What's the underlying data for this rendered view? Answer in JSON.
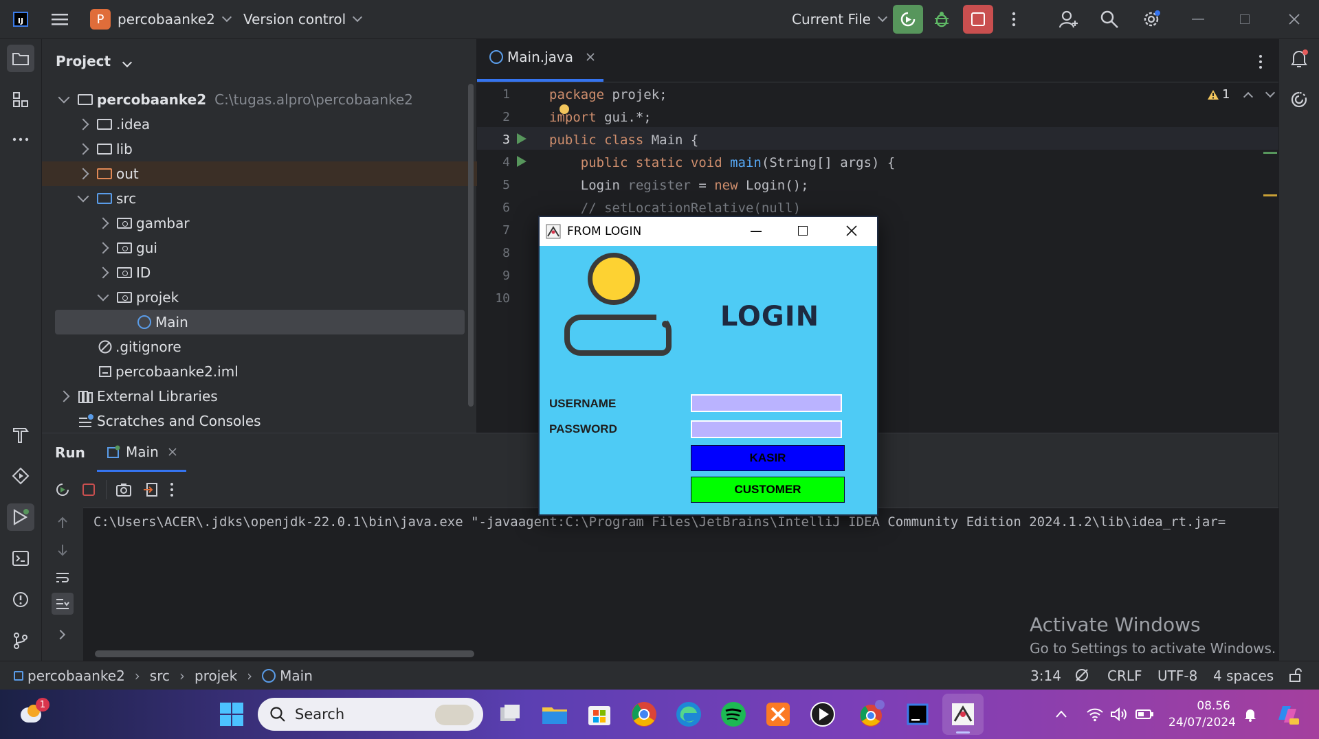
{
  "titlebar": {
    "project_badge": "P",
    "project_name": "percobaanke2",
    "vcs_label": "Version control",
    "run_config": "Current File"
  },
  "project_panel": {
    "header": "Project",
    "root_name": "percobaanke2",
    "root_path": "C:\\tugas.alpro\\percobaanke2",
    "items": [
      {
        "label": ".idea"
      },
      {
        "label": "lib"
      },
      {
        "label": "out"
      },
      {
        "label": "src"
      },
      {
        "label": "gambar"
      },
      {
        "label": "gui"
      },
      {
        "label": "ID"
      },
      {
        "label": "projek"
      },
      {
        "label": "Main"
      },
      {
        "label": ".gitignore"
      },
      {
        "label": "percobaanke2.iml"
      },
      {
        "label": "External Libraries"
      },
      {
        "label": "Scratches and Consoles"
      }
    ]
  },
  "editor": {
    "tab_label": "Main.java",
    "warning_count": "1",
    "line_numbers": [
      "1",
      "2",
      "3",
      "4",
      "5",
      "6",
      "7",
      "8",
      "9",
      "10"
    ],
    "code": {
      "l1_kw": "package",
      "l1_rest": " projek;",
      "l2_kw": "import",
      "l2_rest": " gui.*;",
      "l3_kw": "public class",
      "l3_name": " Main",
      "l3_rest": " {",
      "l4_kw": "    public static void",
      "l4_fn": " main",
      "l4_rest": "(String[] args) {",
      "l5_a": "    Login ",
      "l5_var": "register",
      "l5_b": " = ",
      "l5_kw": "new",
      "l5_c": " Login();",
      "l6_comment": "    // setLocationRelative(null)"
    }
  },
  "run_panel": {
    "title": "Run",
    "tab_label": "Main",
    "console_line": "C:\\Users\\ACER\\.jdks\\openjdk-22.0.1\\bin\\java.exe \"-javaagent:C:\\Program Files\\JetBrains\\IntelliJ IDEA Community Edition 2024.1.2\\lib\\idea_rt.jar=",
    "watermark_title": "Activate Windows",
    "watermark_sub": "Go to Settings to activate Windows."
  },
  "statusbar": {
    "crumbs": [
      "percobaanke2",
      "src",
      "projek",
      "Main"
    ],
    "position": "3:14",
    "line_sep": "CRLF",
    "encoding": "UTF-8",
    "indent": "4 spaces"
  },
  "dialog": {
    "title": "FROM LOGIN",
    "heading": "LOGIN",
    "username_label": "USERNAME",
    "password_label": "PASSWORD",
    "kasir_button": "KASIR",
    "customer_button": "CUSTOMER",
    "colors": {
      "bg": "#4ecbf5",
      "kasir": "#0000ff",
      "customer": "#00ff00",
      "field": "#bab3ff"
    }
  },
  "taskbar": {
    "search_label": "Search",
    "time": "08.56",
    "date": "24/07/2024",
    "notification_count": "1"
  }
}
